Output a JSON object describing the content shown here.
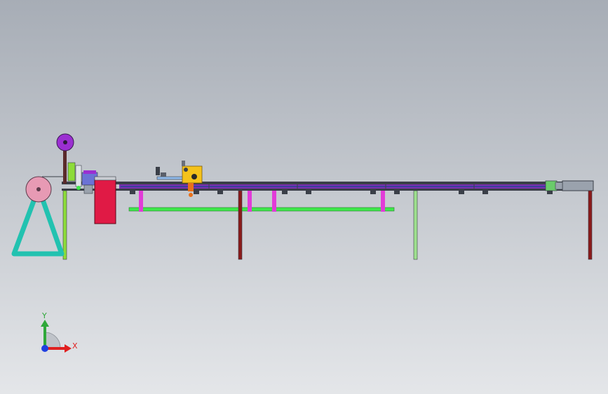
{
  "viewport": {
    "background_top": "#a7adb6",
    "background_bottom": "#e4e6e9"
  },
  "triad": {
    "x_label": "X",
    "y_label": "Y",
    "x_color": "#e02020",
    "y_color": "#2fa83a",
    "z_color": "#2040e0"
  },
  "colors": {
    "frame_dark": "#3a3f48",
    "rail_purple": "#7a2fb0",
    "rail_blue": "#3b3f9a",
    "beam_green": "#3ee84a",
    "post_magenta": "#e23bd8",
    "leg_red": "#8a1a1a",
    "leg_green": "#9ee08e",
    "leg_lime": "#8ddc3a",
    "spool_pink": "#e79ab4",
    "spool_purple": "#9b2fd1",
    "stand_teal": "#22c2b0",
    "box_red": "#e01a45",
    "head_yellow": "#f5c21a",
    "roller_orange": "#e8701a"
  }
}
